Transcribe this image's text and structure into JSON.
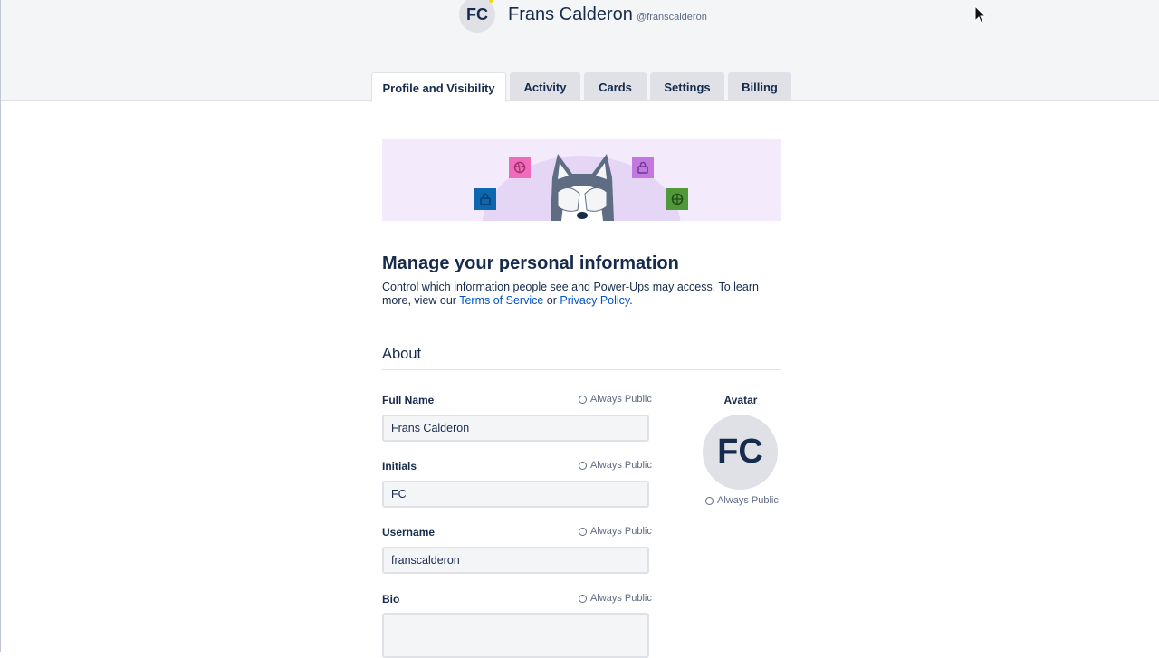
{
  "header": {
    "avatar_initials": "FC",
    "full_name": "Frans Calderon",
    "handle": "@franscalderon"
  },
  "tabs": [
    {
      "label": "Profile and Visibility",
      "active": true
    },
    {
      "label": "Activity",
      "active": false
    },
    {
      "label": "Cards",
      "active": false
    },
    {
      "label": "Settings",
      "active": false
    },
    {
      "label": "Billing",
      "active": false
    }
  ],
  "intro": {
    "title": "Manage your personal information",
    "desc_before": "Control which information people see and Power-Ups may access. To learn more, view our ",
    "terms_link": "Terms of Service",
    "desc_mid": " or ",
    "privacy_link": "Privacy Policy",
    "desc_end": "."
  },
  "about": {
    "section_title": "About",
    "visibility_label": "Always Public",
    "fields": {
      "full_name": {
        "label": "Full Name",
        "value": "Frans Calderon"
      },
      "initials": {
        "label": "Initials",
        "value": "FC"
      },
      "username": {
        "label": "Username",
        "value": "franscalderon"
      },
      "bio": {
        "label": "Bio",
        "value": ""
      }
    },
    "avatar": {
      "label": "Avatar",
      "initials": "FC"
    }
  },
  "colors": {
    "header_bg": "#f4f5f7",
    "link": "#0052cc",
    "text": "#172b4d",
    "muted": "#5e6c84",
    "hero_bg": "#f3ebfb",
    "icon_pink": "#f06bba",
    "icon_purple": "#c377e0",
    "icon_blue": "#0c66b0",
    "icon_green": "#519839"
  }
}
